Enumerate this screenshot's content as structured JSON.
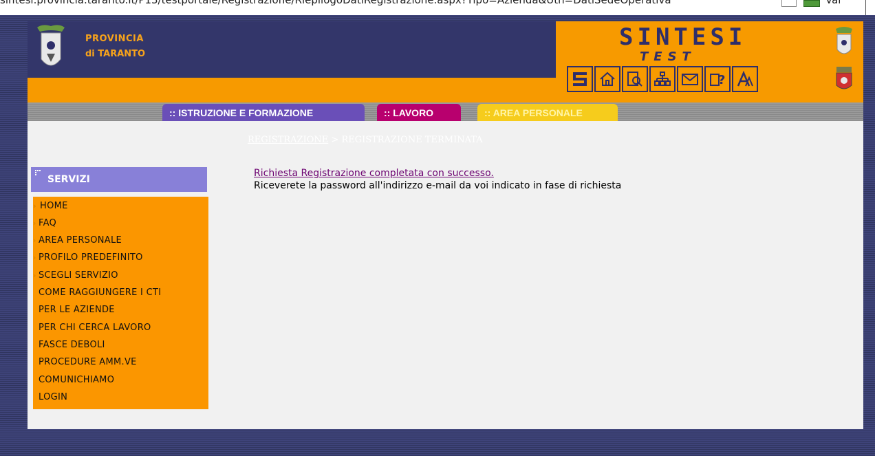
{
  "address_bar": {
    "url": "sintesi.provincia.taranto.it/P13/testportale/Registrazione/RiepilogoDatiRegistrazione.aspx?Tipo=Azienda&Utn=DatiSedeOperativa",
    "go_label": "Vai"
  },
  "header": {
    "province_line1": "PROVINCIA",
    "province_line2": "di TARANTO",
    "logo_text": "SINTESI",
    "logo_subtext": "TEST",
    "toolbar_icons": [
      {
        "name": "sintesi-icon",
        "glyph": "5"
      },
      {
        "name": "home-icon",
        "glyph": "⌂"
      },
      {
        "name": "search-document-icon",
        "glyph": "🔍"
      },
      {
        "name": "sitemap-icon",
        "glyph": "品"
      },
      {
        "name": "mail-icon",
        "glyph": "✉"
      },
      {
        "name": "help-icon",
        "glyph": "?"
      },
      {
        "name": "font-icon",
        "glyph": "A"
      }
    ]
  },
  "tabs": {
    "istruzione": ":: ISTRUZIONE E FORMAZIONE",
    "lavoro": ":: LAVORO",
    "area_personale": ":: AREA PERSONALE"
  },
  "breadcrumb": {
    "link": "REGISTRAZIONE",
    "separator": ">",
    "current": "REGISTRAZIONE TERMINATA"
  },
  "sidebar": {
    "title": "SERVIZI",
    "items": [
      {
        "label": "HOME",
        "arrow": "double"
      },
      {
        "label": "FAQ",
        "arrow": "single"
      },
      {
        "label": "AREA PERSONALE",
        "arrow": "single"
      },
      {
        "label": "PROFILO PREDEFINITO",
        "arrow": "single"
      },
      {
        "label": "SCEGLI SERVIZIO",
        "arrow": "single"
      },
      {
        "label": "COME RAGGIUNGERE I CTI",
        "arrow": "none"
      },
      {
        "label": "PER LE AZIENDE",
        "arrow": "none"
      },
      {
        "label": "PER CHI CERCA LAVORO",
        "arrow": "none"
      },
      {
        "label": "FASCE DEBOLI",
        "arrow": "none"
      },
      {
        "label": "PROCEDURE AMM.VE",
        "arrow": "none"
      },
      {
        "label": "COMUNICHIAMO",
        "arrow": "none"
      },
      {
        "label": "LOGIN",
        "arrow": "none"
      }
    ]
  },
  "message": {
    "success": "Richiesta Registrazione completata con successo.",
    "info": "Riceverete la password all'indirizzo e-mail da voi indicato in fase di richiesta"
  },
  "colors": {
    "header_navy": "#33366a",
    "header_orange": "#f79a00",
    "menu_orange": "#fb9600",
    "servizi_purple": "#8880d8",
    "tab_istruzione": "#6a4fb8",
    "tab_lavoro": "#b8006e",
    "tab_area": "#f6cc1c",
    "success_link": "#6b0070"
  }
}
